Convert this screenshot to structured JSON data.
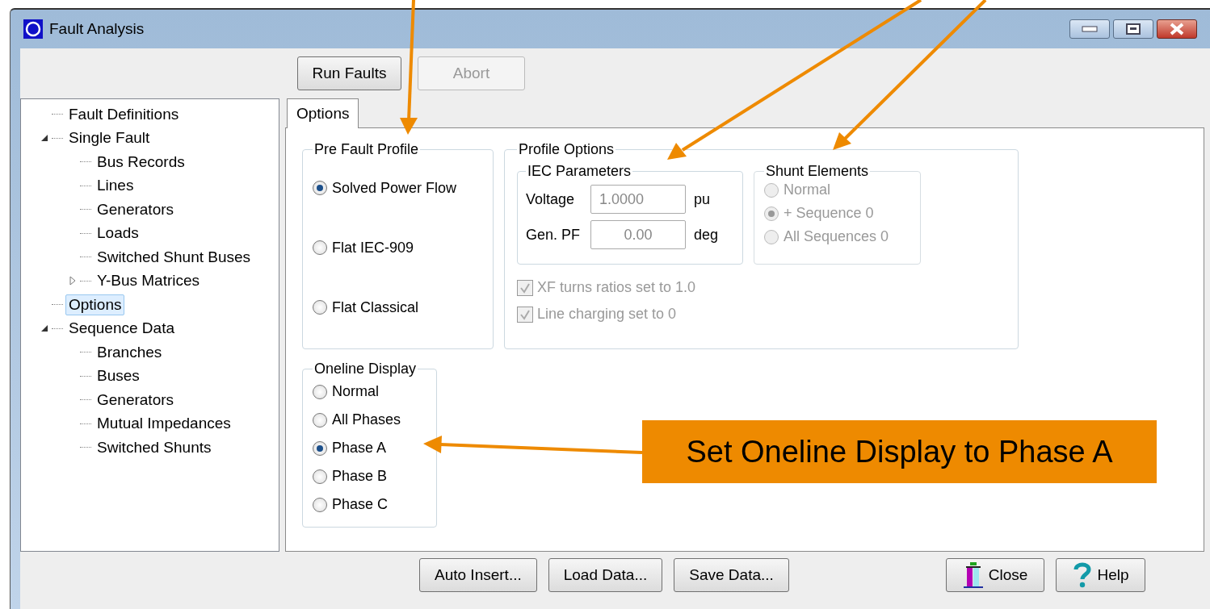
{
  "window": {
    "title": "Fault Analysis"
  },
  "toolbar": [
    {
      "label": "Run Faults",
      "disabled": false
    },
    {
      "label": "Abort",
      "disabled": true
    }
  ],
  "tree": [
    {
      "label": "Fault Definitions",
      "selected": false
    },
    {
      "label": "Single Fault",
      "selected": false,
      "expanded": true,
      "children": [
        {
          "label": "Bus Records",
          "selected": false
        },
        {
          "label": "Lines",
          "selected": false
        },
        {
          "label": "Generators",
          "selected": false
        },
        {
          "label": "Loads",
          "selected": false
        },
        {
          "label": "Switched Shunt Buses",
          "selected": false
        },
        {
          "label": "Y-Bus Matrices",
          "selected": false,
          "expanded": false
        }
      ]
    },
    {
      "label": "Options",
      "selected": true
    },
    {
      "label": "Sequence Data",
      "selected": false,
      "expanded": true,
      "children": [
        {
          "label": "Branches",
          "selected": false
        },
        {
          "label": "Buses",
          "selected": false
        },
        {
          "label": "Generators",
          "selected": false
        },
        {
          "label": "Mutual Impedances",
          "selected": false
        },
        {
          "label": "Switched Shunts",
          "selected": false
        }
      ]
    }
  ],
  "tabs": [
    {
      "label": "Options",
      "selected": true
    }
  ],
  "pre_fault_profile": {
    "title": "Pre Fault Profile",
    "options": [
      {
        "label": "Solved Power Flow",
        "selected": true
      },
      {
        "label": "Flat IEC-909",
        "selected": false
      },
      {
        "label": "Flat Classical",
        "selected": false
      }
    ]
  },
  "profile_options": {
    "title": "Profile Options",
    "iec_parameters": {
      "title": "IEC Parameters",
      "fields": [
        {
          "label": "Voltage",
          "value": "1.0000",
          "unit": "pu",
          "disabled": true
        },
        {
          "label": "Gen. PF",
          "value": "0.00",
          "unit": "deg",
          "disabled": true
        }
      ]
    },
    "shunt_elements": {
      "title": "Shunt Elements",
      "disabled": true,
      "options": [
        {
          "label": "Normal",
          "selected": false
        },
        {
          "label": "+ Sequence 0",
          "selected": true
        },
        {
          "label": "All Sequences 0",
          "selected": false
        }
      ]
    },
    "checkboxes": [
      {
        "label": "XF turns ratios set to 1.0",
        "checked": true,
        "disabled": true
      },
      {
        "label": "Line charging set to 0",
        "checked": true,
        "disabled": true
      }
    ]
  },
  "oneline_display": {
    "title": "Oneline Display",
    "options": [
      {
        "label": "Normal",
        "selected": false
      },
      {
        "label": "All Phases",
        "selected": false
      },
      {
        "label": "Phase A",
        "selected": true
      },
      {
        "label": "Phase B",
        "selected": false
      },
      {
        "label": "Phase C",
        "selected": false
      }
    ]
  },
  "footer_buttons": [
    {
      "label": "Auto Insert...",
      "kind": "text"
    },
    {
      "label": "Load Data...",
      "kind": "text"
    },
    {
      "label": "Save Data...",
      "kind": "text"
    },
    {
      "label": "Close",
      "kind": "door"
    },
    {
      "label": "Help",
      "kind": "help"
    }
  ],
  "callout": {
    "text": "Set Oneline Display to Phase A"
  }
}
